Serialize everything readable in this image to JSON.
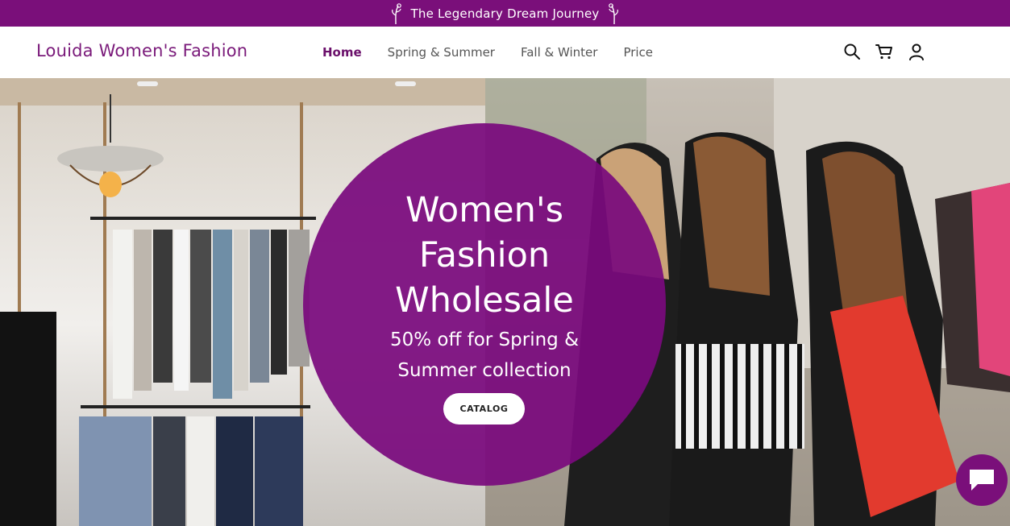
{
  "announcement": {
    "text": "The Legendary Dream Journey",
    "icon": "flower-sprig-icon"
  },
  "header": {
    "brand": "Louida Women's Fashion",
    "nav": [
      {
        "label": "Home",
        "active": true
      },
      {
        "label": "Spring & Summer",
        "active": false
      },
      {
        "label": "Fall & Winter",
        "active": false
      },
      {
        "label": "Price",
        "active": false
      }
    ],
    "actions": [
      "search-icon",
      "cart-icon",
      "account-icon"
    ]
  },
  "hero": {
    "headline_line1": "Women's",
    "headline_line2": "Fashion",
    "headline_line3": "Wholesale",
    "sub_line1": "50% off for Spring &",
    "sub_line2": "Summer collection",
    "cta_label": "CATALOG"
  },
  "chat": {
    "icon": "chat-bubble-icon"
  },
  "colors": {
    "brand_purple": "#7a0f7a",
    "circle_purple": "#7a0a7d",
    "header_bg": "#ffffff"
  }
}
